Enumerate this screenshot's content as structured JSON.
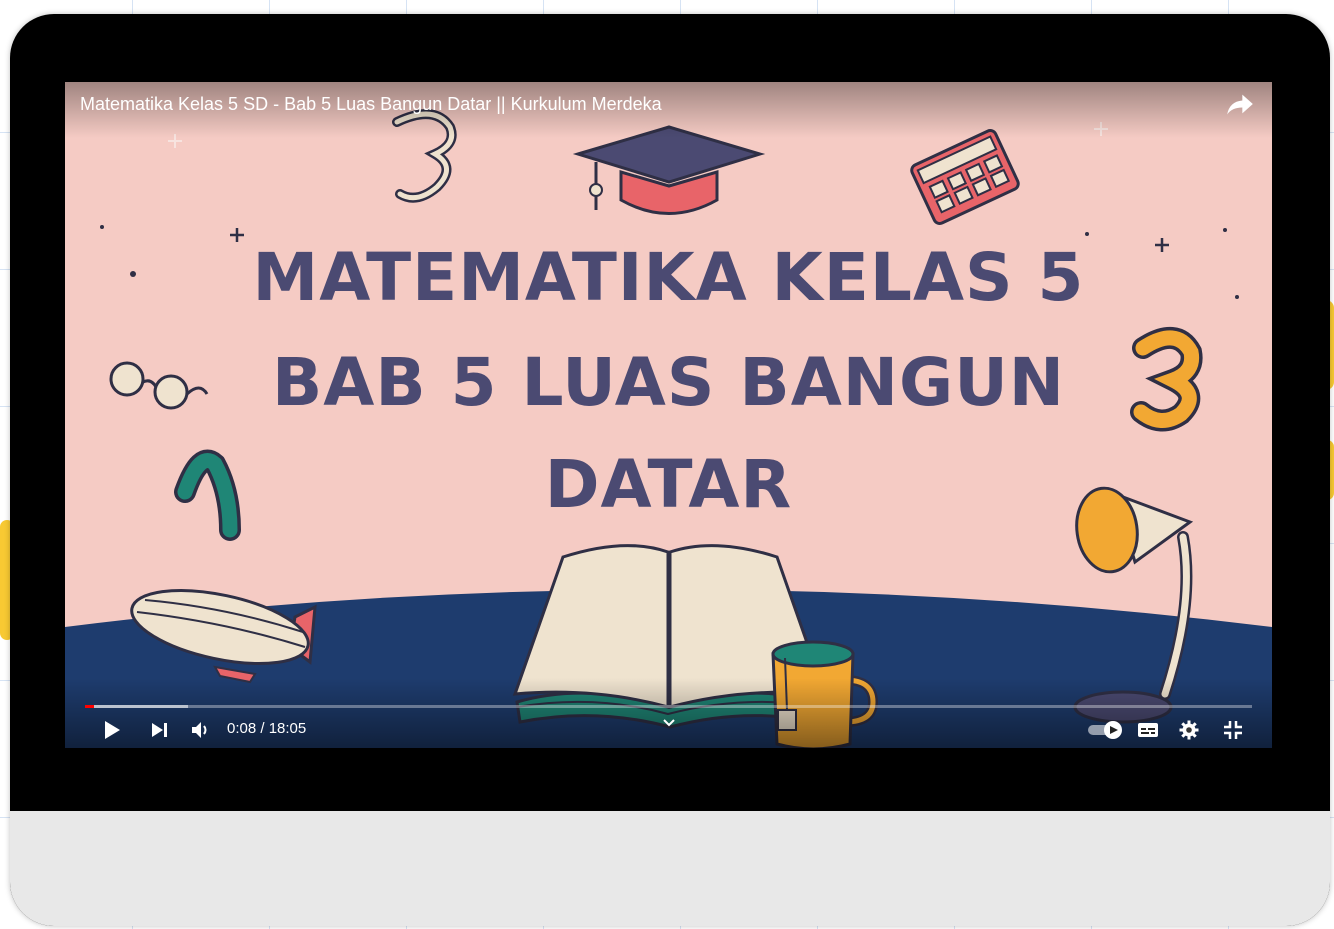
{
  "video": {
    "title": "Matematika Kelas 5 SD - Bab 5 Luas Bangun Datar || Kurkulum Merdeka",
    "thumbnail_lines": [
      "MATEMATIKA KELAS 5",
      "BAB 5 LUAS BANGUN",
      "DATAR"
    ],
    "current_time": "0:08",
    "duration": "18:05",
    "time_label": "0:08 / 18:05",
    "progress_fraction": 0.0074,
    "buffered_fraction": 0.088
  },
  "icons": {
    "share": "share-icon",
    "play": "play-icon",
    "next": "next-icon",
    "volume": "volume-icon",
    "chevron": "chevron-down-icon",
    "autoplay": "autoplay-toggle-icon",
    "subtitles": "subtitles-icon",
    "settings": "gear-icon",
    "fullscreen": "exit-fullscreen-icon"
  },
  "colors": {
    "screen_background": "#f5cbc4",
    "headline": "#4b4a72",
    "desk": "#1e3c6e",
    "progress_played": "#ff0000",
    "monitor_frame": "#000000",
    "monitor_chin": "#e8e8e8"
  }
}
